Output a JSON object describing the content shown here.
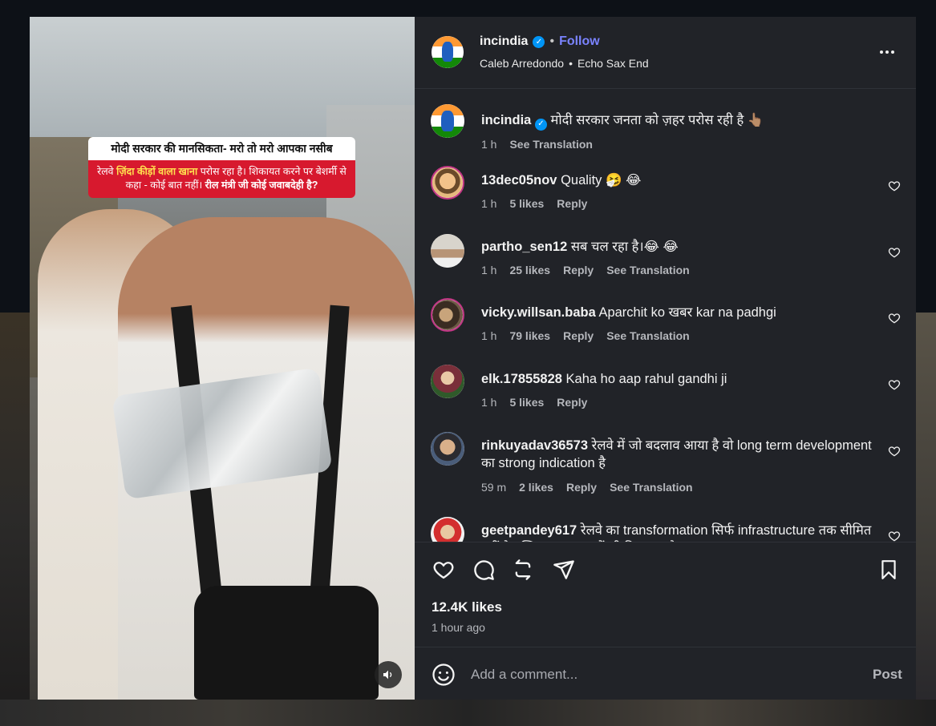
{
  "post": {
    "username": "incindia",
    "follow_label": "Follow",
    "audio_artist": "Caleb Arredondo",
    "audio_track": "Echo Sax End",
    "caption_text": "मोदी सरकार जनता को ज़हर परोस रही है 👆🏽",
    "caption_time": "1 h",
    "caption_translate": "See Translation",
    "likes": "12.4K likes",
    "posted_ago": "1 hour ago"
  },
  "media": {
    "overlay_title": "मोदी सरकार की मानसिकता- मरो तो मरो आपका नसीब",
    "overlay_line1_a": "रेलवे ",
    "overlay_line1_b": "ज़िंदा कीड़ों वाला खाना",
    "overlay_line1_c": " परोस रहा है। शिकायत करने पर बेशर्मी से कहा - कोई बात नहीं। ",
    "overlay_line1_d": "रील मंत्री जी कोई जवाबदेही है?"
  },
  "comments": [
    {
      "username": "13dec05nov",
      "text": "Quality 🤧 😂",
      "time": "1 h",
      "likes": "5 likes",
      "reply": "Reply",
      "translate": ""
    },
    {
      "username": "partho_sen12",
      "text": "सब चल रहा है।😂 😂",
      "time": "1 h",
      "likes": "25 likes",
      "reply": "Reply",
      "translate": "See Translation"
    },
    {
      "username": "vicky.willsan.baba",
      "text": "Aparchit ko खबर kar na padhgi",
      "time": "1 h",
      "likes": "79 likes",
      "reply": "Reply",
      "translate": "See Translation"
    },
    {
      "username": "elk.17855828",
      "text": "Kaha ho aap rahul gandhi ji",
      "time": "1 h",
      "likes": "5 likes",
      "reply": "Reply",
      "translate": ""
    },
    {
      "username": "rinkuyadav36573",
      "text": "रेलवे में जो बदलाव आया है वो long term development का strong indication है",
      "time": "59 m",
      "likes": "2 likes",
      "reply": "Reply",
      "translate": "See Translation"
    },
    {
      "username": "geetpandey617",
      "text": "रेलवे का transformation सिर्फ infrastructure तक सीमित नहीं है बल्कि services में भी दिख रहा है",
      "time": "",
      "likes": "",
      "reply": "",
      "translate": ""
    }
  ],
  "composer": {
    "placeholder": "Add a comment...",
    "post_label": "Post"
  },
  "icons": [
    "verified-badge-icon",
    "more-options-icon",
    "heart-icon",
    "comment-icon",
    "repost-icon",
    "share-icon",
    "bookmark-icon",
    "emoji-icon",
    "volume-icon"
  ],
  "colors": {
    "follow": "#7a83ff",
    "verified": "#0095f6",
    "pane_bg": "#212328",
    "overlay_red": "#d7192e"
  }
}
